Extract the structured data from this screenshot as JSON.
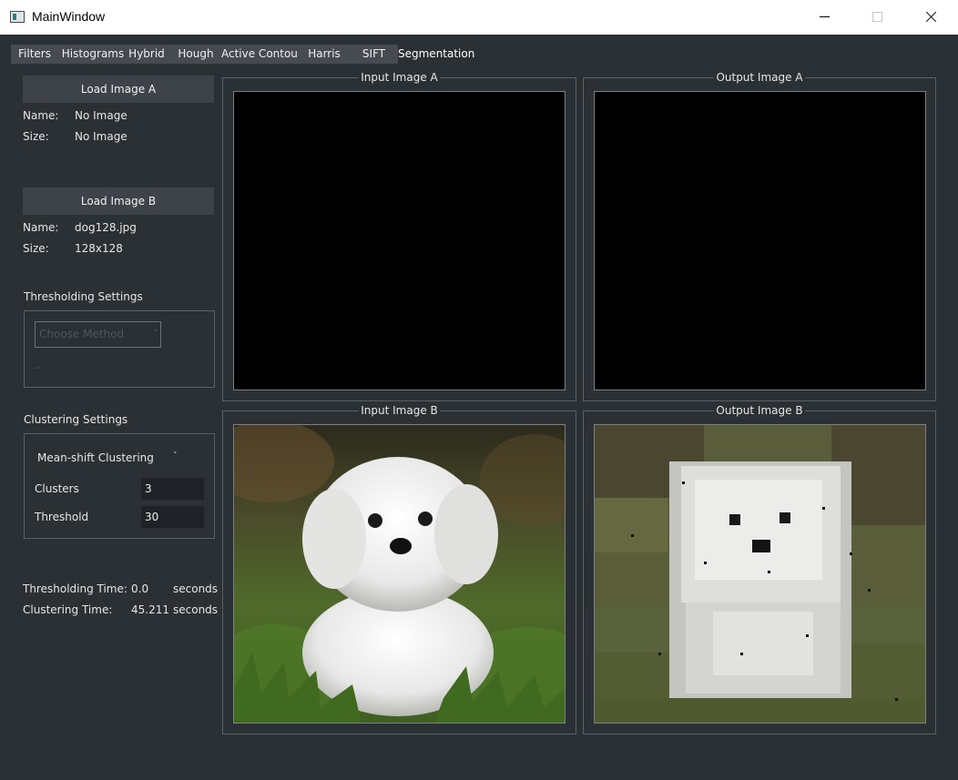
{
  "window": {
    "title": "MainWindow"
  },
  "tabs": [
    {
      "label": "Filters"
    },
    {
      "label": "Histograms"
    },
    {
      "label": "Hybrid"
    },
    {
      "label": "Hough"
    },
    {
      "label": "Active Contour"
    },
    {
      "label": "Harris"
    },
    {
      "label": "SIFT"
    },
    {
      "label": "Segmentation",
      "active": true
    }
  ],
  "image_a": {
    "button_label": "Load Image A",
    "name_label": "Name:",
    "name_value": "No Image",
    "size_label": "Size:",
    "size_value": "No Image"
  },
  "image_b": {
    "button_label": "Load Image B",
    "name_label": "Name:",
    "name_value": "dog128.jpg",
    "size_label": "Size:",
    "size_value": "128x128"
  },
  "thresholding": {
    "title": "Thresholding Settings",
    "method_placeholder": "Choose Method",
    "extra_label": "..."
  },
  "clustering": {
    "title": "Clustering Settings",
    "method": "Mean-shift Clustering",
    "clusters_label": "Clusters",
    "clusters_value": "3",
    "threshold_label": "Threshold",
    "threshold_value": "30"
  },
  "timing": {
    "thresholding_label": "Thresholding Time:",
    "thresholding_value": "0.0",
    "thresholding_unit": "seconds",
    "clustering_label": "Clustering Time:",
    "clustering_value": "45.211",
    "clustering_unit": "seconds"
  },
  "views": {
    "input_a": "Input Image A",
    "output_a": "Output Image A",
    "input_b": "Input Image B",
    "output_b": "Output Image B"
  },
  "colors": {
    "background": "#2b3035",
    "tab_bg": "#454b51",
    "button_bg": "#3d4349",
    "spin_bg": "#1f2327"
  }
}
